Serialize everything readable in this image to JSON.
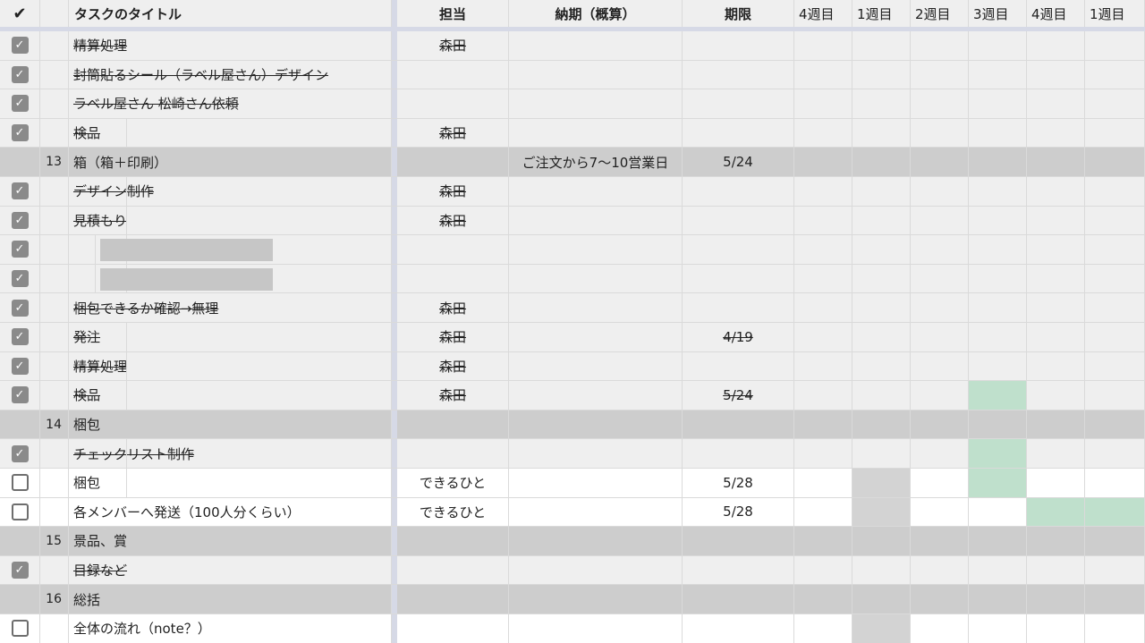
{
  "header": {
    "check": "✔",
    "title": "タスクのタイトル",
    "owner": "担当",
    "eta": "納期（概算）",
    "due": "期限",
    "weeks": [
      "4週目",
      "1週目",
      "2週目",
      "3週目",
      "4週目",
      "1週目"
    ]
  },
  "rows": [
    {
      "type": "done",
      "num": "",
      "title": "精算処理",
      "owner": "森田",
      "eta": "",
      "due": ""
    },
    {
      "type": "done",
      "num": "",
      "title": "封筒貼るシール（ラベル屋さん）デザイン",
      "owner": "",
      "eta": "",
      "due": ""
    },
    {
      "type": "done",
      "num": "",
      "title": "ラベル屋さん 松崎さん依頼",
      "owner": "",
      "eta": "",
      "due": ""
    },
    {
      "type": "done",
      "num": "",
      "title": "検品",
      "owner": "森田",
      "eta": "",
      "due": ""
    },
    {
      "type": "section",
      "num": "13",
      "title": "箱（箱＋印刷）",
      "owner": "",
      "eta": "ご注文から7〜10営業日",
      "due": "5/24"
    },
    {
      "type": "done",
      "num": "",
      "title": "デザイン制作",
      "owner": "森田",
      "eta": "",
      "due": ""
    },
    {
      "type": "done",
      "num": "",
      "title": "見積もり",
      "owner": "森田",
      "eta": "",
      "due": ""
    },
    {
      "type": "done",
      "num": "",
      "title": "",
      "owner": "",
      "eta": "",
      "due": ""
    },
    {
      "type": "done",
      "num": "",
      "title": "",
      "owner": "",
      "eta": "",
      "due": ""
    },
    {
      "type": "done",
      "num": "",
      "title": "梱包できるか確認→無理",
      "owner": "森田",
      "eta": "",
      "due": ""
    },
    {
      "type": "done",
      "num": "",
      "title": "発注",
      "owner": "森田",
      "eta": "",
      "due": "4/19"
    },
    {
      "type": "done",
      "num": "",
      "title": "精算処理",
      "owner": "森田",
      "eta": "",
      "due": ""
    },
    {
      "type": "done",
      "num": "",
      "title": "検品",
      "owner": "森田",
      "eta": "",
      "due": "5/24"
    },
    {
      "type": "section",
      "num": "14",
      "title": "梱包",
      "owner": "",
      "eta": "",
      "due": ""
    },
    {
      "type": "done",
      "num": "",
      "title": "チェックリスト制作",
      "owner": "",
      "eta": "",
      "due": ""
    },
    {
      "type": "open",
      "num": "",
      "title": "梱包",
      "owner": "できるひと",
      "eta": "",
      "due": "5/28"
    },
    {
      "type": "open",
      "num": "",
      "title": "各メンバーへ発送（100人分くらい）",
      "owner": "できるひと",
      "eta": "",
      "due": "5/28"
    },
    {
      "type": "section",
      "num": "15",
      "title": "景品、賞",
      "owner": "",
      "eta": "",
      "due": ""
    },
    {
      "type": "done",
      "num": "",
      "title": "目録など",
      "owner": "",
      "eta": "",
      "due": ""
    },
    {
      "type": "section",
      "num": "16",
      "title": "総括",
      "owner": "",
      "eta": "",
      "due": ""
    },
    {
      "type": "open",
      "num": "",
      "title": "全体の流れ（note？）",
      "owner": "",
      "eta": "",
      "due": ""
    }
  ],
  "colors": {
    "done_bg": "#efefef",
    "section_bg": "#cdcdcd",
    "week_grey": "#d3d3d3",
    "week_green": "#bfe0cc"
  }
}
